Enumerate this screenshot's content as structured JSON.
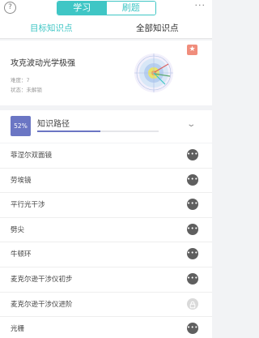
{
  "header": {
    "segments": [
      {
        "label": "学习",
        "active": true
      },
      {
        "label": "刷题",
        "active": false
      }
    ],
    "help_icon": "question-mark-circle",
    "more_icon": "ellipsis"
  },
  "subtabs": [
    {
      "label": "目标知识点",
      "active": true
    },
    {
      "label": "全部知识点",
      "active": false
    }
  ],
  "card": {
    "title": "攻克波动光学极强",
    "difficulty_text": "难度：7",
    "status_text": "状态：未解锁",
    "badge_icon": "star"
  },
  "path": {
    "percent_label": "52%",
    "progress": 0.52,
    "label": "知识路径",
    "chevron": "chevron-down"
  },
  "items": [
    {
      "label": "菲涅尔双面镜",
      "icon": "dots"
    },
    {
      "label": "劳埃镜",
      "icon": "dots"
    },
    {
      "label": "平行光干涉",
      "icon": "dots"
    },
    {
      "label": "劈尖",
      "icon": "dots"
    },
    {
      "label": "牛顿环",
      "icon": "dots"
    },
    {
      "label": "麦克尔逊干涉仪初步",
      "icon": "dots"
    },
    {
      "label": "麦克尔逊干涉仪进阶",
      "icon": "lock"
    },
    {
      "label": "光栅",
      "icon": "dots"
    }
  ],
  "colors": {
    "accent": "#3fc6c5",
    "path": "#6b76c4",
    "badge": "#f08d7c"
  }
}
